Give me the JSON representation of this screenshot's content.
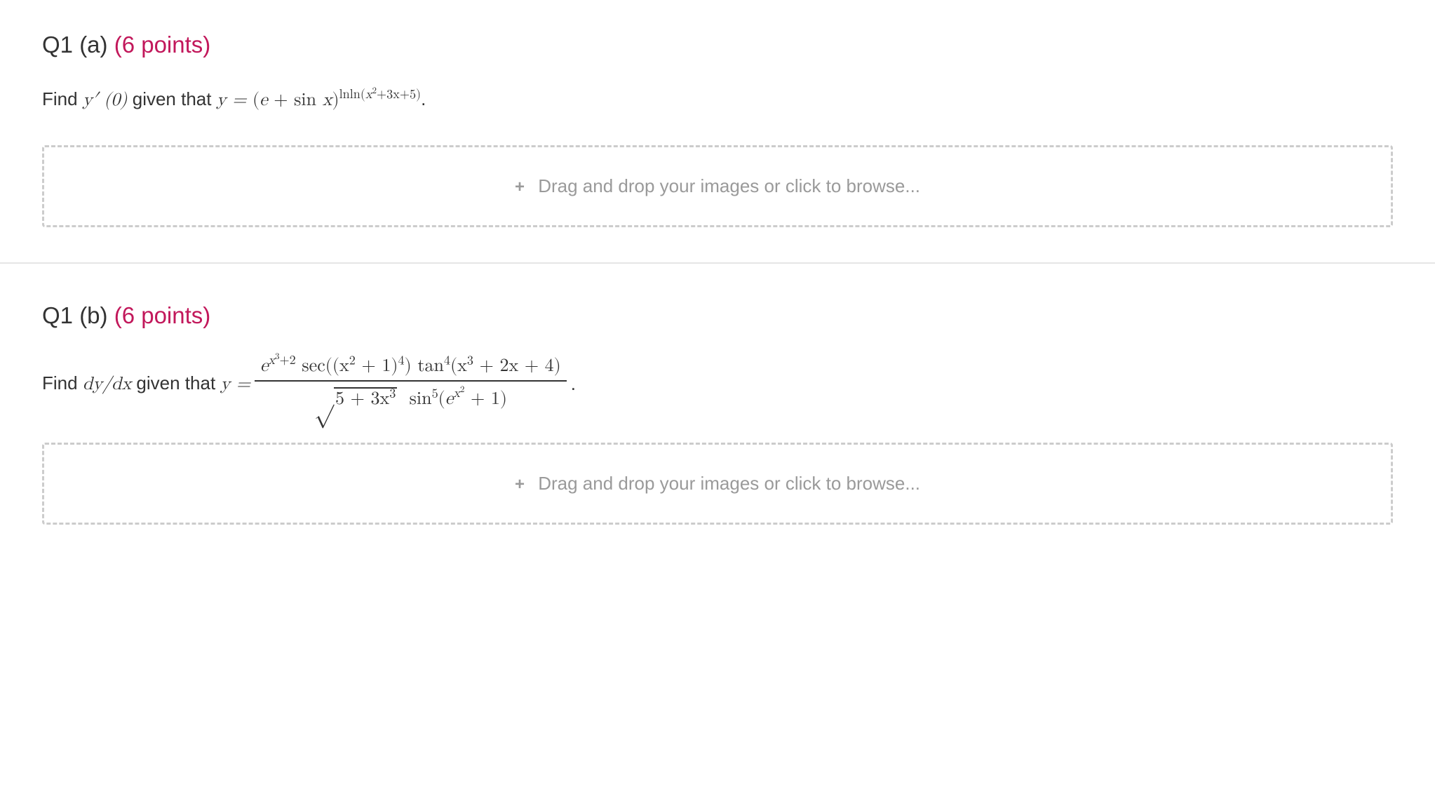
{
  "questions": {
    "q1a": {
      "label": "Q1 (a)",
      "points": "(6 points)",
      "text_prefix": "Find ",
      "text_given": " given that ",
      "math_find": "y′ (0)",
      "math_eq_lhs": "y = ",
      "math_base": "(e + sin x)",
      "math_exp_prefix": "ln(",
      "math_exp_inner": "x",
      "math_exp_sup": "2",
      "math_exp_suffix": "+3x+5)",
      "period": "."
    },
    "q1b": {
      "label": "Q1 (b)",
      "points": "(6 points)",
      "text_prefix": "Find ",
      "text_given": " given that ",
      "math_find": "dy/dx",
      "math_eq_lhs": "y = ",
      "numerator": {
        "e_exp_base": "x",
        "e_exp_sup": "3",
        "e_exp_tail": "+2",
        "sec_arg_base": "(x",
        "sec_arg_sup": "2",
        "sec_arg_tail": " + 1)",
        "sec_outer_sup": "4",
        "tan_sup": "4",
        "tan_arg_base": "(x",
        "tan_arg_sup": "3",
        "tan_arg_tail": " + 2x + 4)"
      },
      "denominator": {
        "sqrt_inner_lead": "5 + 3x",
        "sqrt_inner_sup": "3",
        "sin_sup": "5",
        "sin_e_base": "x",
        "sin_e_sup": "2",
        "sin_tail": " + 1)"
      },
      "period": "."
    }
  },
  "dropzone": {
    "text": "Drag and drop your images or click to browse...",
    "plus": "+"
  },
  "labels": {
    "sec": "sec",
    "tan": "tan",
    "sin": "sin",
    "ln": "ln",
    "e": "e"
  }
}
